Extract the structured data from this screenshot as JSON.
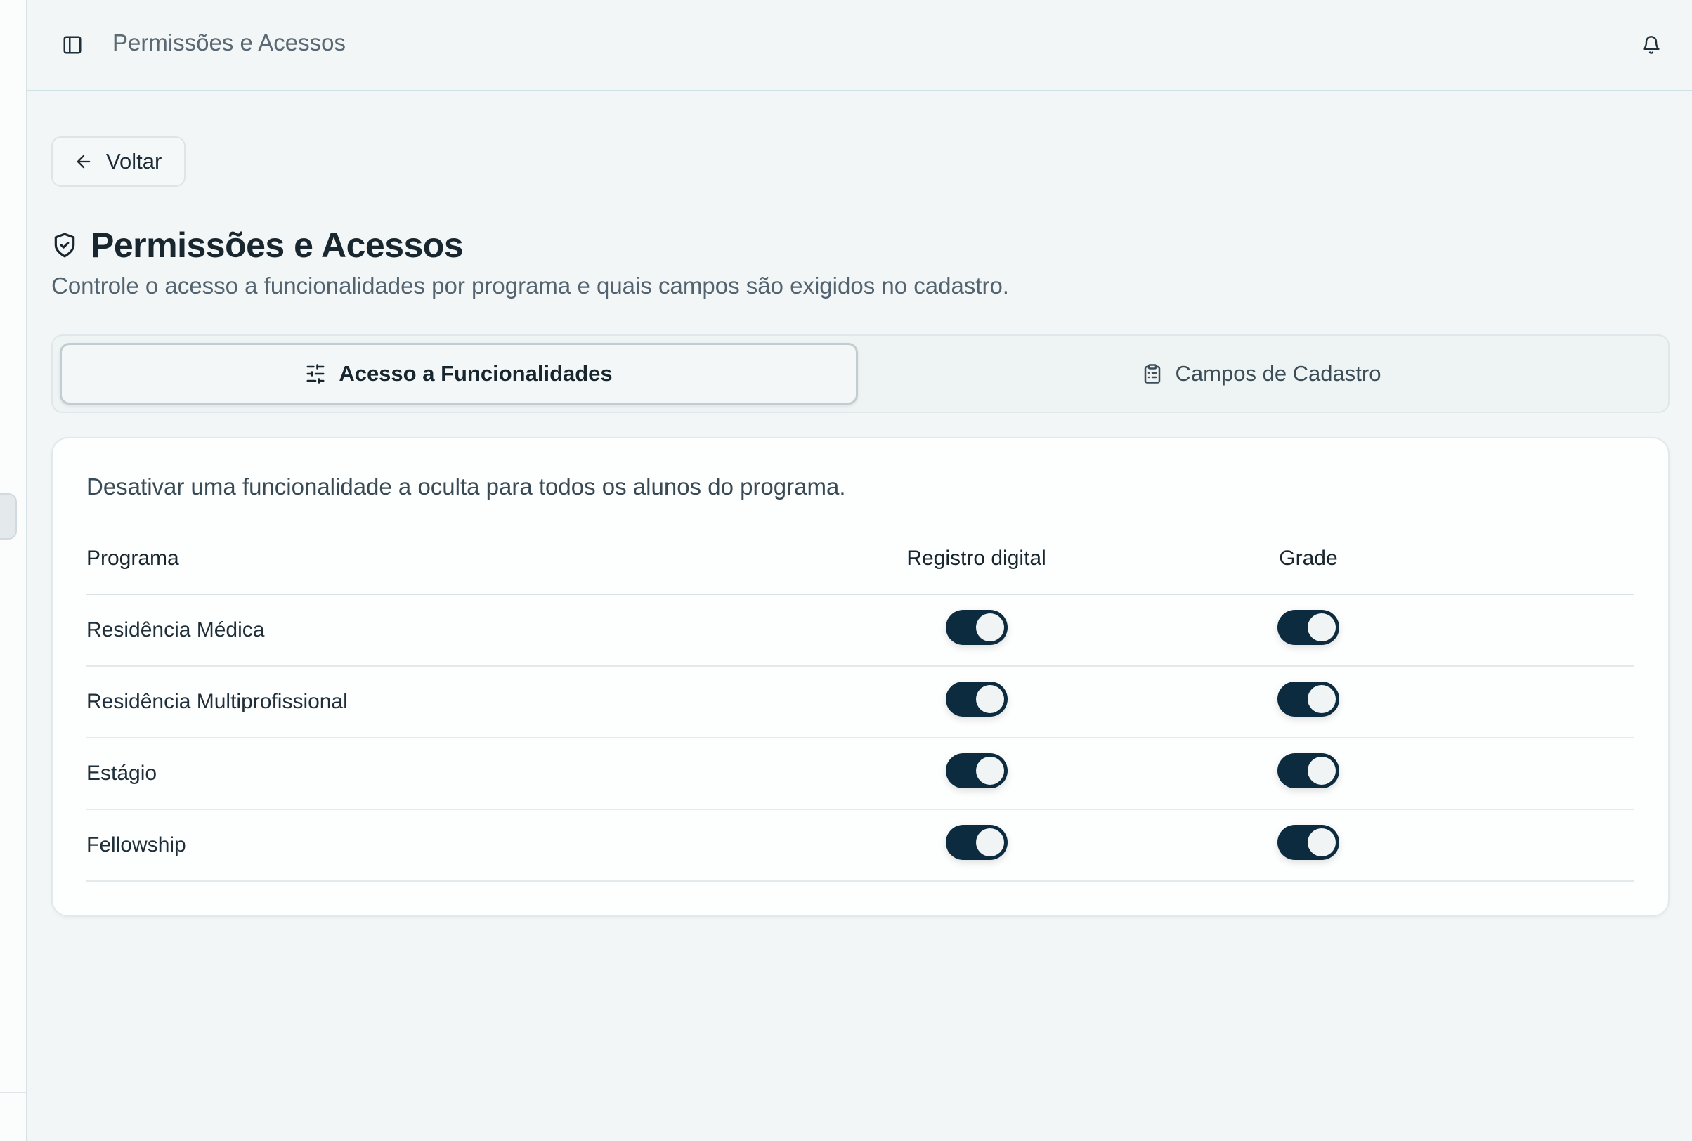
{
  "topbar": {
    "title": "Permissões e Acessos"
  },
  "back": {
    "label": "Voltar"
  },
  "page": {
    "title": "Permissões e Acessos",
    "subtitle": "Controle o acesso a funcionalidades por programa e quais campos são exigidos no cadastro."
  },
  "tabs": [
    {
      "label": "Acesso a Funcionalidades",
      "icon": "sliders-icon",
      "active": true
    },
    {
      "label": "Campos de Cadastro",
      "icon": "clipboard-icon",
      "active": false
    }
  ],
  "card": {
    "description": "Desativar uma funcionalidade a oculta para todos os alunos do programa."
  },
  "table": {
    "headers": {
      "program": "Programa",
      "registro": "Registro digital",
      "grade": "Grade"
    },
    "rows": [
      {
        "program": "Residência Médica",
        "registro": true,
        "grade": true
      },
      {
        "program": "Residência Multiprofissional",
        "registro": true,
        "grade": true
      },
      {
        "program": "Estágio",
        "registro": true,
        "grade": true
      },
      {
        "program": "Fellowship",
        "registro": true,
        "grade": true
      }
    ]
  },
  "colors": {
    "accent": "#0d2b3f",
    "background": "#f3f6f6"
  }
}
